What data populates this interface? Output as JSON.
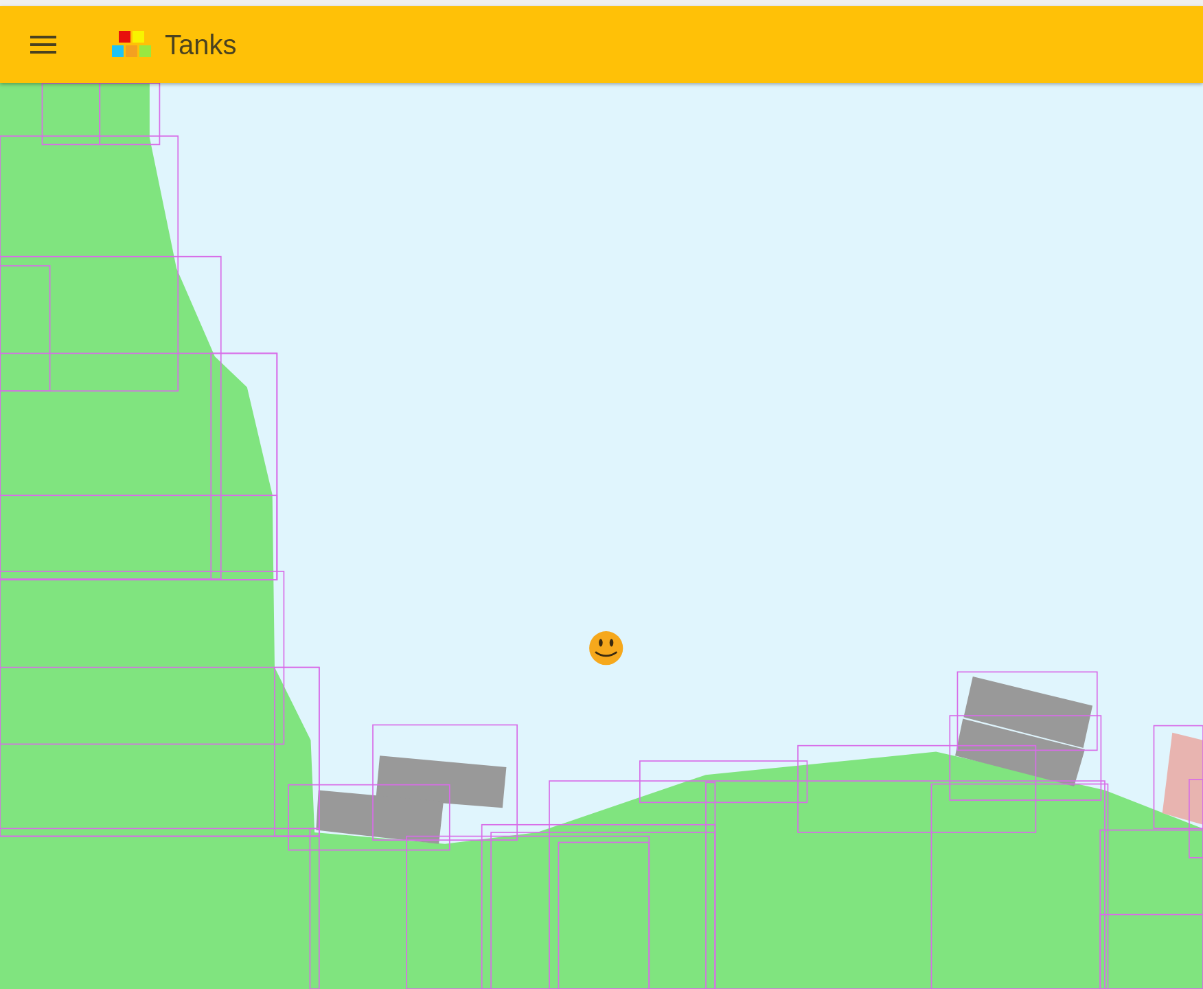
{
  "app_bar": {
    "title": "Tanks"
  }
}
